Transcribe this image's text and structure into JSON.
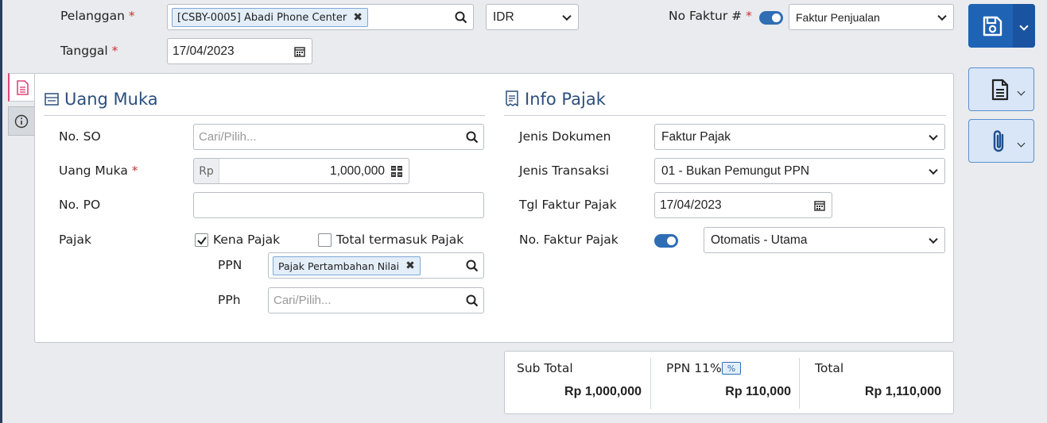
{
  "header": {
    "customer_label": "Pelanggan",
    "customer_tag": "[CSBY-0005] Abadi Phone Center",
    "currency": "IDR",
    "invoice_no_label": "No Faktur #",
    "invoice_type": "Faktur Penjualan",
    "date_label": "Tanggal",
    "date_value": "17/04/2023",
    "required_mark": "*"
  },
  "down_payment": {
    "title": "Uang Muka",
    "so_label": "No. SO",
    "so_placeholder": "Cari/Pilih...",
    "amount_label": "Uang Muka",
    "amount_prefix": "Rp",
    "amount_value": "1,000,000",
    "po_label": "No. PO",
    "po_value": "",
    "tax_label": "Pajak",
    "taxable_label": "Kena Pajak",
    "taxable_checked": true,
    "tax_included_label": "Total termasuk Pajak",
    "tax_included_checked": false,
    "ppn_label": "PPN",
    "ppn_tag": "Pajak Pertambahan Nilai",
    "pph_label": "PPh",
    "pph_placeholder": "Cari/Pilih..."
  },
  "tax_info": {
    "title": "Info Pajak",
    "doc_type_label": "Jenis Dokumen",
    "doc_type_value": "Faktur Pajak",
    "trans_type_label": "Jenis Transaksi",
    "trans_type_value": "01 - Bukan Pemungut PPN",
    "tax_invoice_date_label": "Tgl Faktur Pajak",
    "tax_invoice_date_value": "17/04/2023",
    "tax_invoice_no_label": "No. Faktur Pajak",
    "tax_invoice_no_value": "Otomatis - Utama"
  },
  "summary": {
    "subtotal_label": "Sub Total",
    "subtotal_value": "Rp 1,000,000",
    "ppn_label": "PPN 11%",
    "ppn_badge": "%",
    "ppn_value": "Rp 110,000",
    "total_label": "Total",
    "total_value": "Rp 1,110,000"
  },
  "colors": {
    "accent": "#1f63b5",
    "title": "#2c4f7c",
    "required": "#d32f2f"
  }
}
